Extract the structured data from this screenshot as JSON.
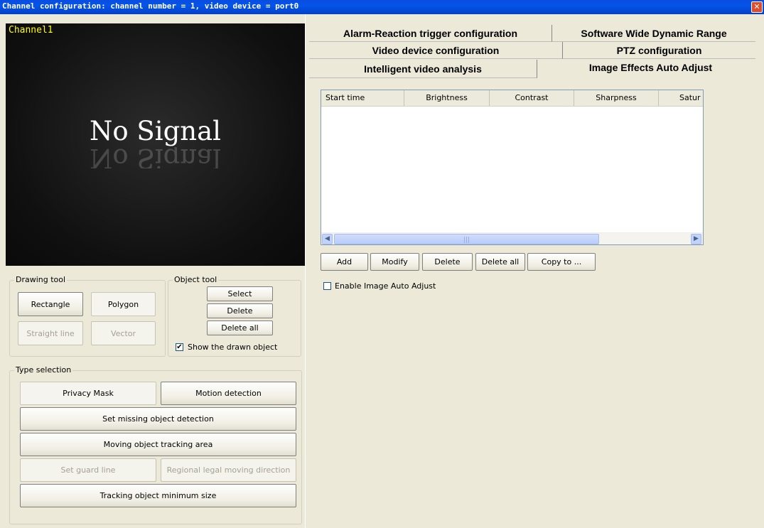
{
  "window": {
    "title": "Channel configuration: channel number = 1, video device = port0",
    "close_glyph": "✕"
  },
  "video": {
    "channel_label": "Channel1",
    "no_signal": "No Signal"
  },
  "drawing_tool": {
    "legend": "Drawing tool",
    "rectangle": "Rectangle",
    "polygon": "Polygon",
    "straight_line": "Straight line",
    "vector": "Vector"
  },
  "object_tool": {
    "legend": "Object tool",
    "select": "Select",
    "delete": "Delete",
    "delete_all": "Delete all",
    "show_drawn": "Show the drawn object",
    "show_drawn_checked": true
  },
  "type_selection": {
    "legend": "Type selection",
    "privacy_mask": "Privacy Mask",
    "motion_detection": "Motion detection",
    "missing_object": "Set missing object detection",
    "tracking_area": "Moving object tracking area",
    "guard_line": "Set guard line",
    "legal_direction": "Regional legal moving direction",
    "min_size": "Tracking object minimum size"
  },
  "tabs": {
    "alarm": "Alarm-Reaction trigger configuration",
    "wdr": "Software Wide Dynamic Range",
    "video_device": "Video device configuration",
    "ptz": "PTZ configuration",
    "iva": "Intelligent video analysis",
    "image_effects": "Image Effects Auto Adjust"
  },
  "table": {
    "columns": [
      "Start time",
      "Brightness",
      "Contrast",
      "Sharpness",
      "Satur"
    ],
    "rows": []
  },
  "actions": {
    "add": "Add",
    "modify": "Modify",
    "delete": "Delete",
    "delete_all": "Delete all",
    "copy_to": "Copy to ..."
  },
  "auto_adjust": {
    "label": "Enable Image Auto Adjust",
    "checked": false
  },
  "icons": {
    "close": "close-icon",
    "scroll_left": "arrow-left-icon",
    "scroll_right": "arrow-right-icon",
    "check": "check-icon"
  },
  "colors": {
    "titlebar": "#0554e8",
    "channel_label": "#ffff00",
    "face": "#ece9d8"
  }
}
